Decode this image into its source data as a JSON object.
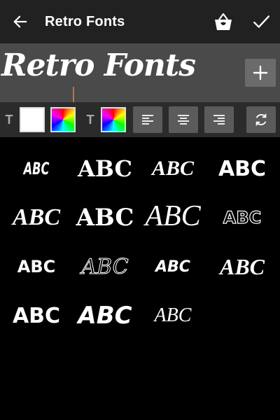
{
  "appbar": {
    "title": "Retro Fonts",
    "back_icon": "arrow-left-icon",
    "store_icon": "shopping-basket-icon",
    "done_icon": "checkmark-icon"
  },
  "preview": {
    "text": "Retro Fonts",
    "add_icon": "plus-icon",
    "cursor_color": "#e0672b"
  },
  "toolbar": {
    "text_color_label": "T",
    "bg_color_label": "T",
    "white_color": "#ffffff",
    "icons": [
      "align-left-icon",
      "align-center-icon",
      "align-right-icon",
      "rotate-icon"
    ]
  },
  "fonts": [
    {
      "label": "ABC"
    },
    {
      "label": "ABC"
    },
    {
      "label": "ABC"
    },
    {
      "label": "ABC"
    },
    {
      "label": "ABC"
    },
    {
      "label": "ABC"
    },
    {
      "label": "ABC"
    },
    {
      "label": "ABC"
    },
    {
      "label": "ABC"
    },
    {
      "label": "ABC"
    },
    {
      "label": "ABC"
    },
    {
      "label": "ABC"
    },
    {
      "label": "ABC"
    },
    {
      "label": "ABC"
    },
    {
      "label": "ABC"
    }
  ]
}
